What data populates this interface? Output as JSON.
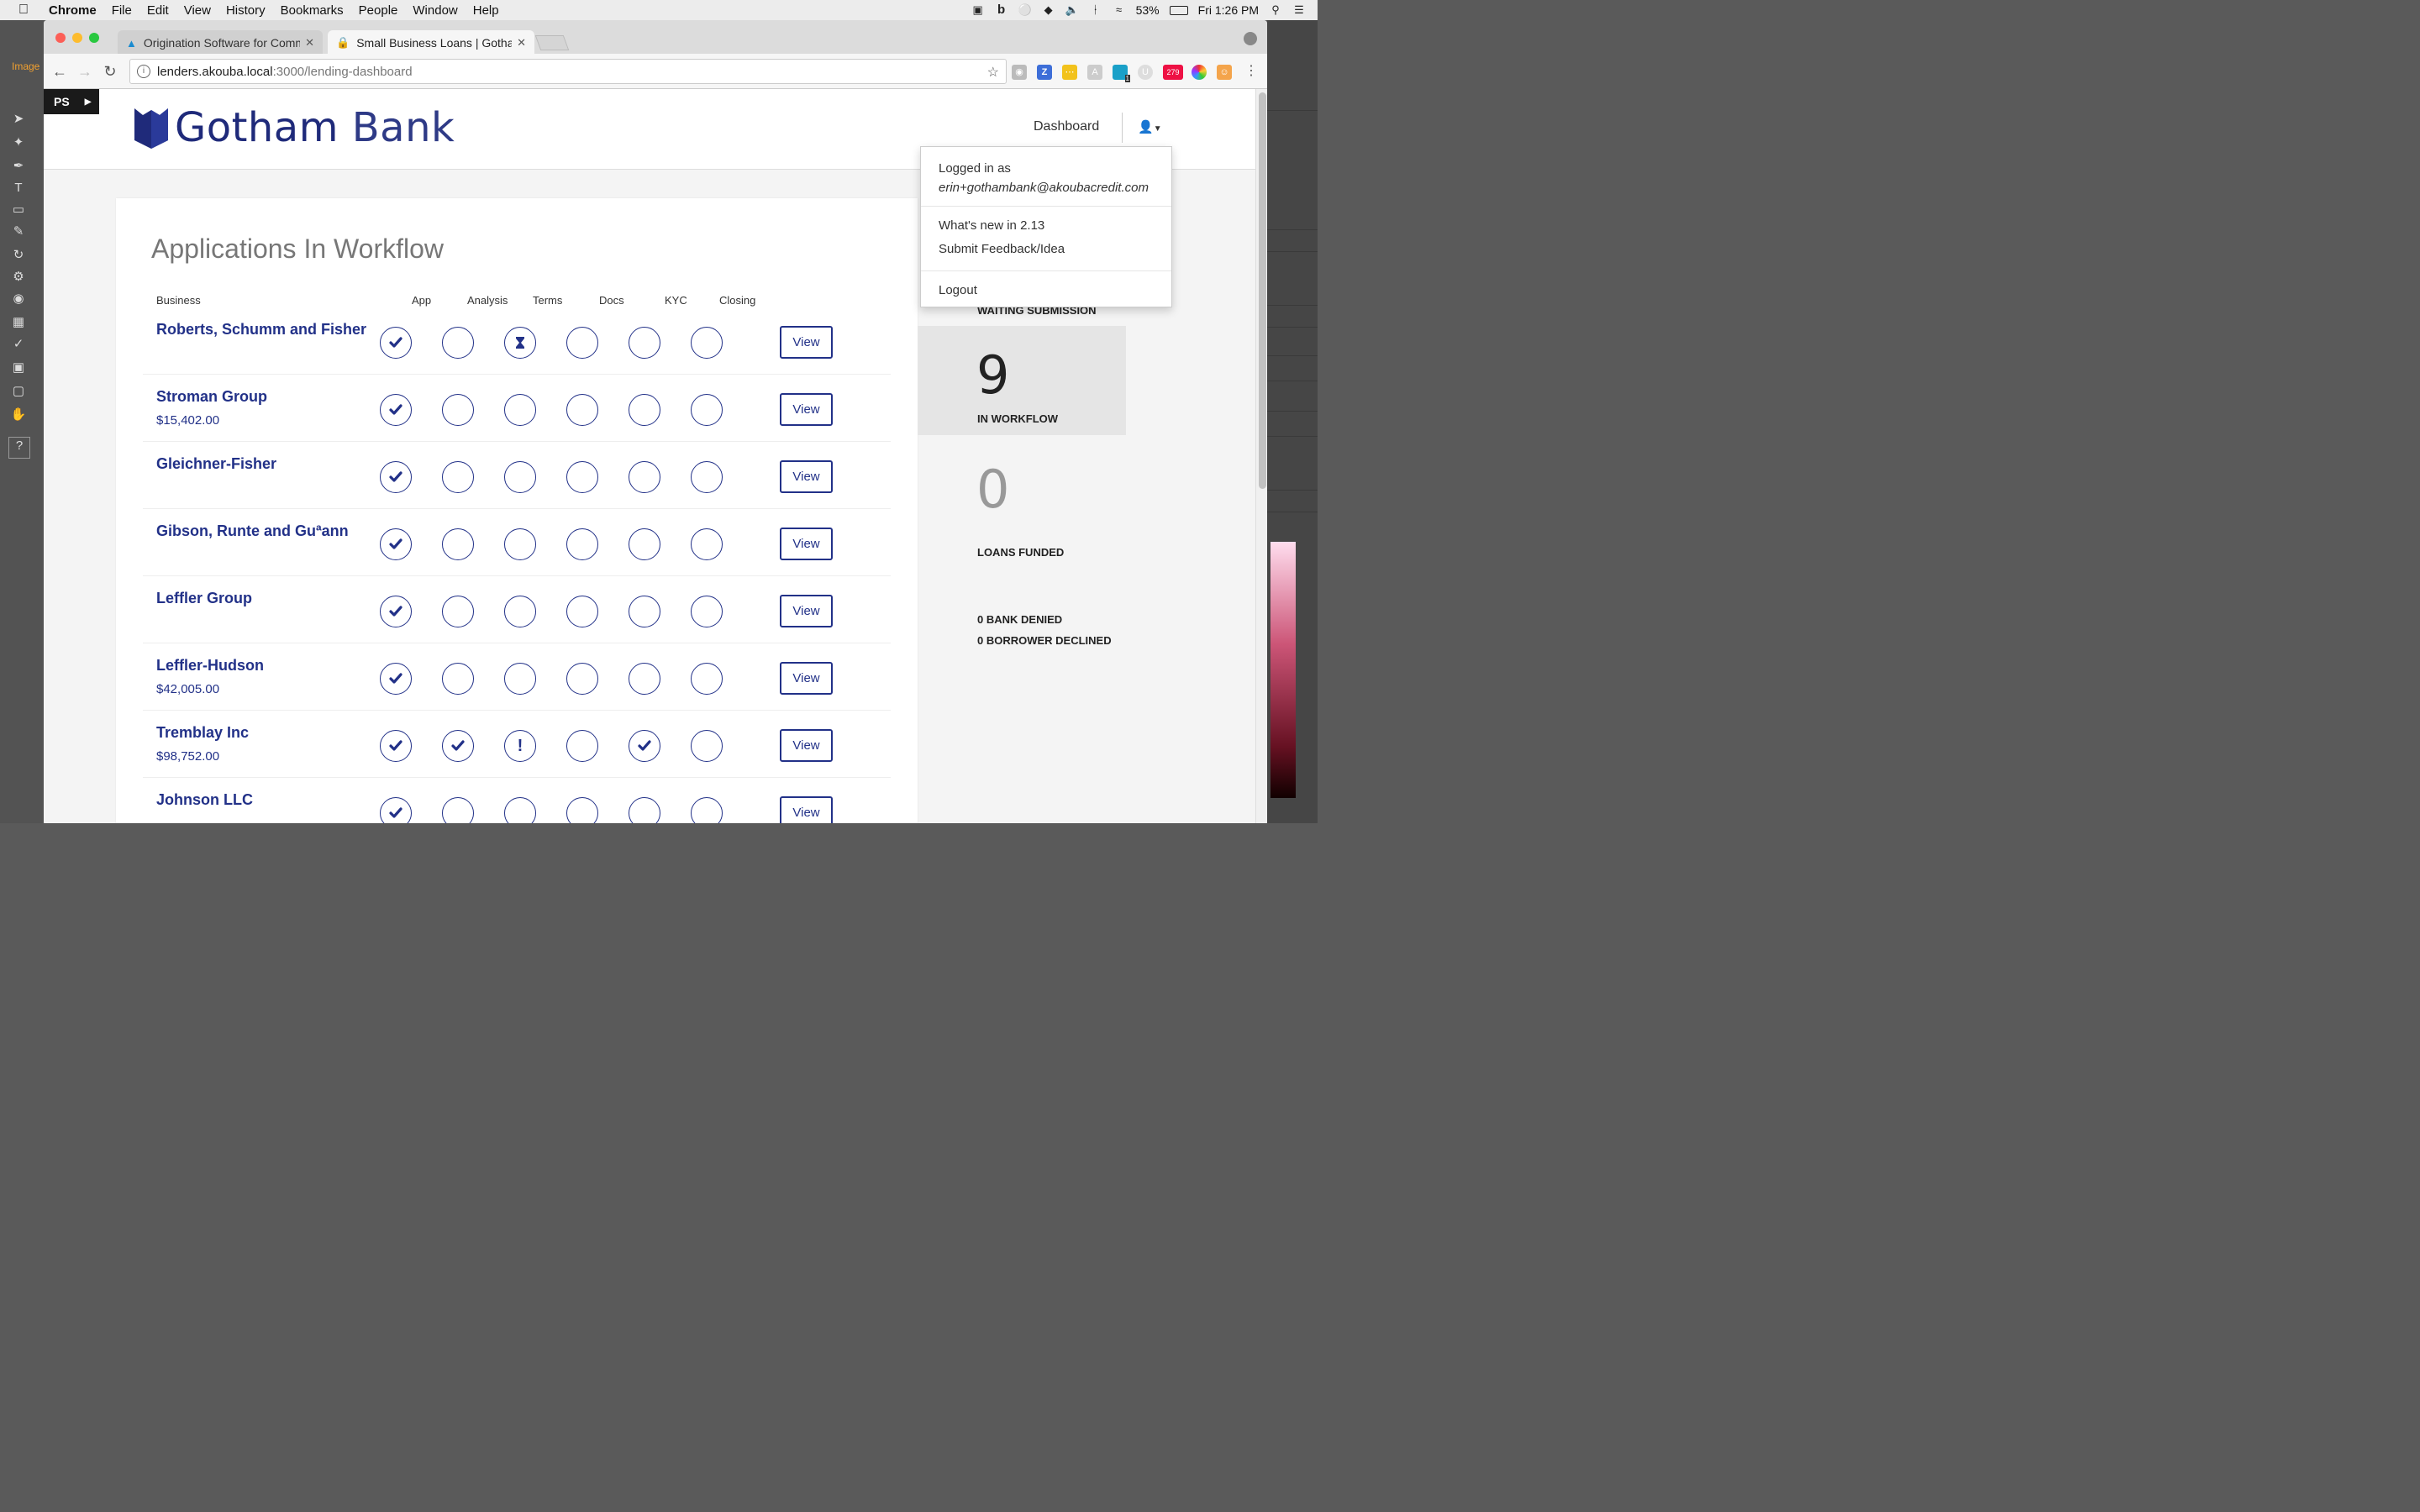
{
  "menubar": {
    "app": "Chrome",
    "items": [
      "File",
      "Edit",
      "View",
      "History",
      "Bookmarks",
      "People",
      "Window",
      "Help"
    ],
    "battery": "53%",
    "clock": "Fri 1:26 PM"
  },
  "photoshop": {
    "image_tab": "Image",
    "ps_badge": "PS"
  },
  "browser": {
    "tabs": [
      {
        "label": "Origination Software for Comm",
        "active": false
      },
      {
        "label": "Small Business Loans | Gotham",
        "active": true
      }
    ],
    "url_host": "lenders.akouba.local",
    "url_path": ":3000/lending-dashboard",
    "ext_badge_1": "1",
    "ext_badge_279": "279"
  },
  "header": {
    "logo_bold": "Gotham",
    "logo_light": "Bank",
    "nav_dashboard": "Dashboard"
  },
  "workflow": {
    "title": "Applications In Workflow",
    "columns": {
      "business": "Business",
      "app": "App",
      "analysis": "Analysis",
      "terms": "Terms",
      "docs": "Docs",
      "kyc": "KYC",
      "closing": "Closing"
    },
    "view_label": "View",
    "rows": [
      {
        "name": "Roberts, Schumm and Fisher",
        "amount": "",
        "steps": [
          "done",
          "empty",
          "pending",
          "empty",
          "empty",
          "empty"
        ]
      },
      {
        "name": "Stroman Group",
        "amount": "$15,402.00",
        "steps": [
          "done",
          "empty",
          "empty",
          "empty",
          "empty",
          "empty"
        ]
      },
      {
        "name": "Gleichner-Fisher",
        "amount": "",
        "steps": [
          "done",
          "empty",
          "empty",
          "empty",
          "empty",
          "empty"
        ]
      },
      {
        "name": "Gibson, Runte and Guªann",
        "amount": "",
        "steps": [
          "done",
          "empty",
          "empty",
          "empty",
          "empty",
          "empty"
        ]
      },
      {
        "name": "Leffler Group",
        "amount": "",
        "steps": [
          "done",
          "empty",
          "empty",
          "empty",
          "empty",
          "empty"
        ]
      },
      {
        "name": "Leffler-Hudson",
        "amount": "$42,005.00",
        "steps": [
          "done",
          "empty",
          "empty",
          "empty",
          "empty",
          "empty"
        ]
      },
      {
        "name": "Tremblay Inc",
        "amount": "$98,752.00",
        "steps": [
          "done",
          "done",
          "alert",
          "empty",
          "done",
          "empty"
        ]
      },
      {
        "name": "Johnson LLC",
        "amount": "",
        "steps": [
          "done",
          "empty",
          "empty",
          "empty",
          "empty",
          "empty"
        ]
      }
    ]
  },
  "stats": {
    "waiting_label": "WAITING SUBMISSION",
    "in_workflow_value": "9",
    "in_workflow_label": "IN WORKFLOW",
    "funded_value": "0",
    "funded_label": "LOANS FUNDED",
    "bank_denied": "0 BANK DENIED",
    "borrower_declined": "0 BORROWER DECLINED"
  },
  "user_menu": {
    "logged_in_as": "Logged in as",
    "email": "erin+gothambank@akoubacredit.com",
    "whats_new": "What's new in 2.13",
    "feedback": "Submit Feedback/Idea",
    "logout": "Logout"
  },
  "colors": {
    "brand": "#223188",
    "logo": "#1f2a7a",
    "stat_bg": "#e5e5e5"
  }
}
